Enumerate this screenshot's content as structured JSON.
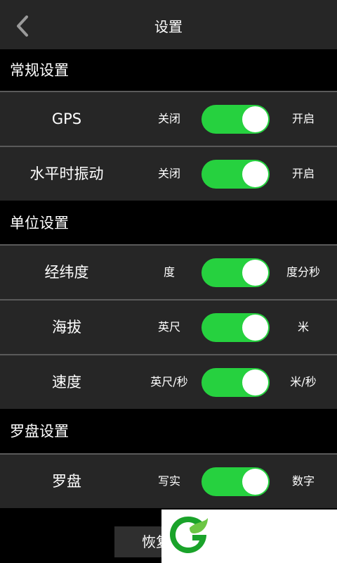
{
  "header": {
    "title": "设置",
    "back_icon": "chevron-left-icon"
  },
  "sections": [
    {
      "title": "常规设置"
    },
    {
      "title": "单位设置"
    },
    {
      "title": "罗盘设置"
    }
  ],
  "rows": {
    "gps": {
      "label": "GPS",
      "left": "关闭",
      "right": "开启",
      "on": true
    },
    "vibrate": {
      "label": "水平时振动",
      "left": "关闭",
      "right": "开启",
      "on": true
    },
    "latlon": {
      "label": "经纬度",
      "left": "度",
      "right": "度分秒",
      "on": true
    },
    "altitude": {
      "label": "海拔",
      "left": "英尺",
      "right": "米",
      "on": true
    },
    "speed": {
      "label": "速度",
      "left": "英尺/秒",
      "right": "米/秒",
      "on": true
    },
    "compass": {
      "label": "罗盘",
      "left": "写实",
      "right": "数字",
      "on": true
    }
  },
  "footer": {
    "restore_label": "恢复"
  },
  "colors": {
    "toggle_on": "#26d13f",
    "row_bg": "#262626",
    "section_bg": "#000000",
    "logo_green": "#1aa32a"
  }
}
